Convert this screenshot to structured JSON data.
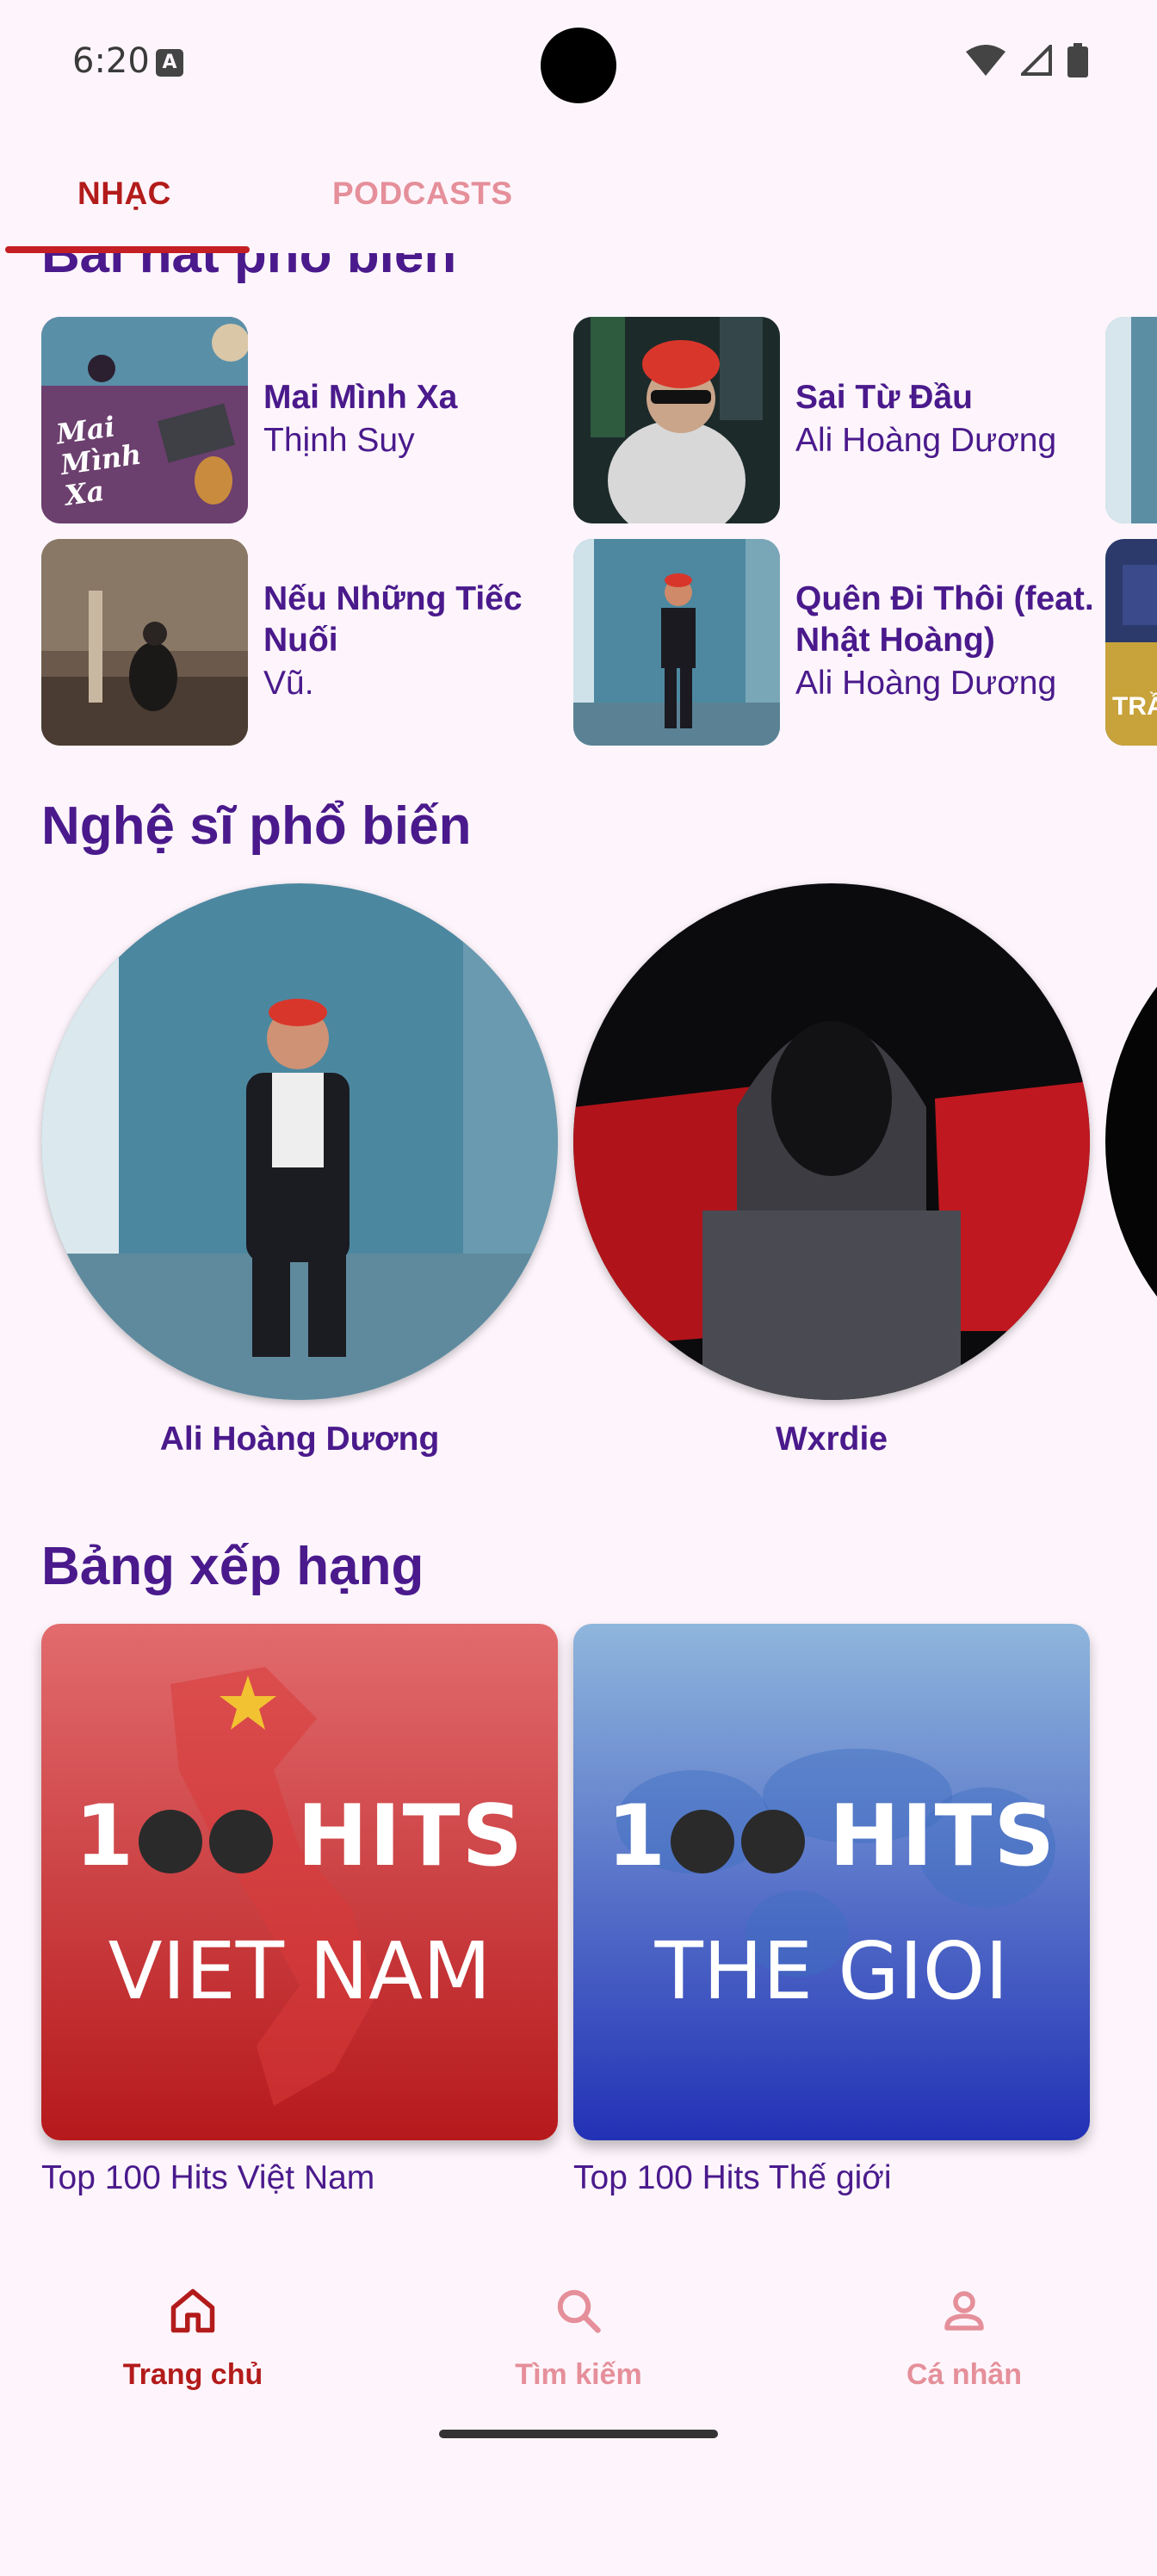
{
  "status_bar": {
    "time": "6:20",
    "notification_glyph": "A"
  },
  "tabs": [
    {
      "label": "NHẠC",
      "active": true
    },
    {
      "label": "PODCASTS",
      "active": false
    }
  ],
  "sections": {
    "popular_songs": "Bài hát phổ biến",
    "popular_artists": "Nghệ sĩ phổ biến",
    "charts": "Bảng xếp hạng"
  },
  "songs": [
    {
      "title": "Mai Mình Xa",
      "artist": "Thịnh Suy",
      "cover_text": "Mai Mình Xa"
    },
    {
      "title": "Sai Từ Đầu",
      "artist": "Ali Hoàng Dương"
    },
    {
      "title": "Nếu Những Tiếc Nuối",
      "artist": "Vũ."
    },
    {
      "title": "Quên Đi Thôi (feat. Nhật Hoàng)",
      "artist": "Ali Hoàng Dương"
    },
    {
      "cover_text": "TRẦ"
    }
  ],
  "artists": [
    {
      "name": "Ali Hoàng Dương"
    },
    {
      "name": "Wxrdie"
    }
  ],
  "charts": [
    {
      "big": "1",
      "hits": "HITS",
      "region": "VIET NAM",
      "label": "Top 100 Hits Việt Nam"
    },
    {
      "big": "1",
      "hits": "HITS",
      "region": "THE GIOI",
      "label": "Top 100 Hits Thế giới"
    }
  ],
  "nav": [
    {
      "label": "Trang chủ",
      "icon": "home-icon",
      "active": true
    },
    {
      "label": "Tìm kiếm",
      "icon": "search-icon",
      "active": false
    },
    {
      "label": "Cá nhân",
      "icon": "person-icon",
      "active": false
    }
  ],
  "colors": {
    "background": "#fdf5fb",
    "accent": "#c31f24",
    "inactive": "#e58f9a",
    "heading": "#4a1a8c"
  }
}
